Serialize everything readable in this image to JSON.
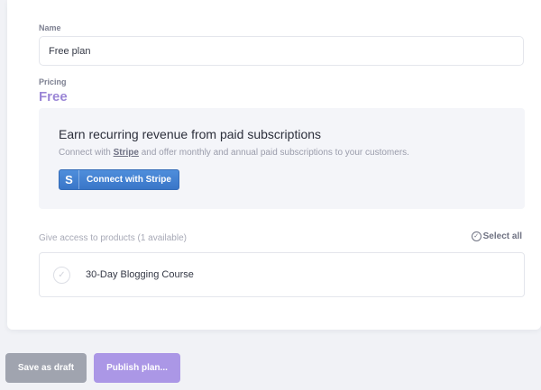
{
  "form": {
    "name_label": "Name",
    "name_value": "Free plan",
    "pricing_label": "Pricing",
    "pricing_value": "Free"
  },
  "stripe": {
    "heading": "Earn recurring revenue from paid subscriptions",
    "desc_before": "Connect with ",
    "desc_link": "Stripe",
    "desc_after": " and offer monthly and annual paid subscriptions to your customers.",
    "button_icon": "S",
    "button_label": "Connect with Stripe"
  },
  "products": {
    "label": "Give access to products (1 available)",
    "select_all": "Select all",
    "items": [
      {
        "name": "30-Day Blogging Course"
      }
    ]
  },
  "actions": {
    "save_draft": "Save as draft",
    "publish": "Publish plan..."
  }
}
